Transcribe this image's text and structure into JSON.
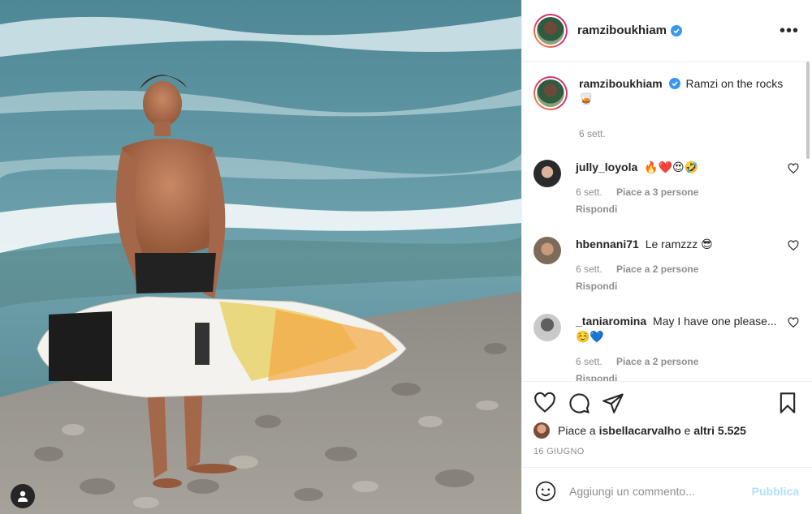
{
  "header": {
    "username": "ramziboukhiam",
    "more_glyph": "•••"
  },
  "caption": {
    "username": "ramziboukhiam",
    "text": "Ramzi on the rocks 🥃",
    "time": "6 sett."
  },
  "comments": [
    {
      "username": "jully_loyola",
      "text": "🔥❤️😍🤣",
      "time": "6 sett.",
      "likes": "Piace a 3 persone",
      "reply": "Rispondi",
      "avatar_color": "#2a2a2a"
    },
    {
      "username": "hbennani71",
      "text": "Le ramzzz 😎",
      "time": "6 sett.",
      "likes": "Piace a 2 persone",
      "reply": "Rispondi",
      "avatar_color": "#7d6b5a"
    },
    {
      "username": "_taniaromina",
      "text": "May I have one please... ☺️💙",
      "time": "6 sett.",
      "likes": "Piace a 2 persone",
      "reply": "Rispondi",
      "avatar_color": "#9a9a9a"
    }
  ],
  "likes": {
    "prefix": "Piace a",
    "user": "isbellacarvalho",
    "middle": "e",
    "others": "altri 5.525"
  },
  "date": "16 GIUGNO",
  "add_comment": {
    "placeholder": "Aggiungi un commento...",
    "publish": "Pubblica"
  },
  "icons": [
    "more-icon",
    "verified-icon",
    "heart-icon",
    "comment-icon",
    "share-icon",
    "bookmark-icon",
    "emoji-icon",
    "user-tag-icon"
  ],
  "colors": {
    "verified_blue": "#3897f0",
    "publish_disabled": "#b2dffc",
    "secondary_text": "#8e8e8e"
  }
}
